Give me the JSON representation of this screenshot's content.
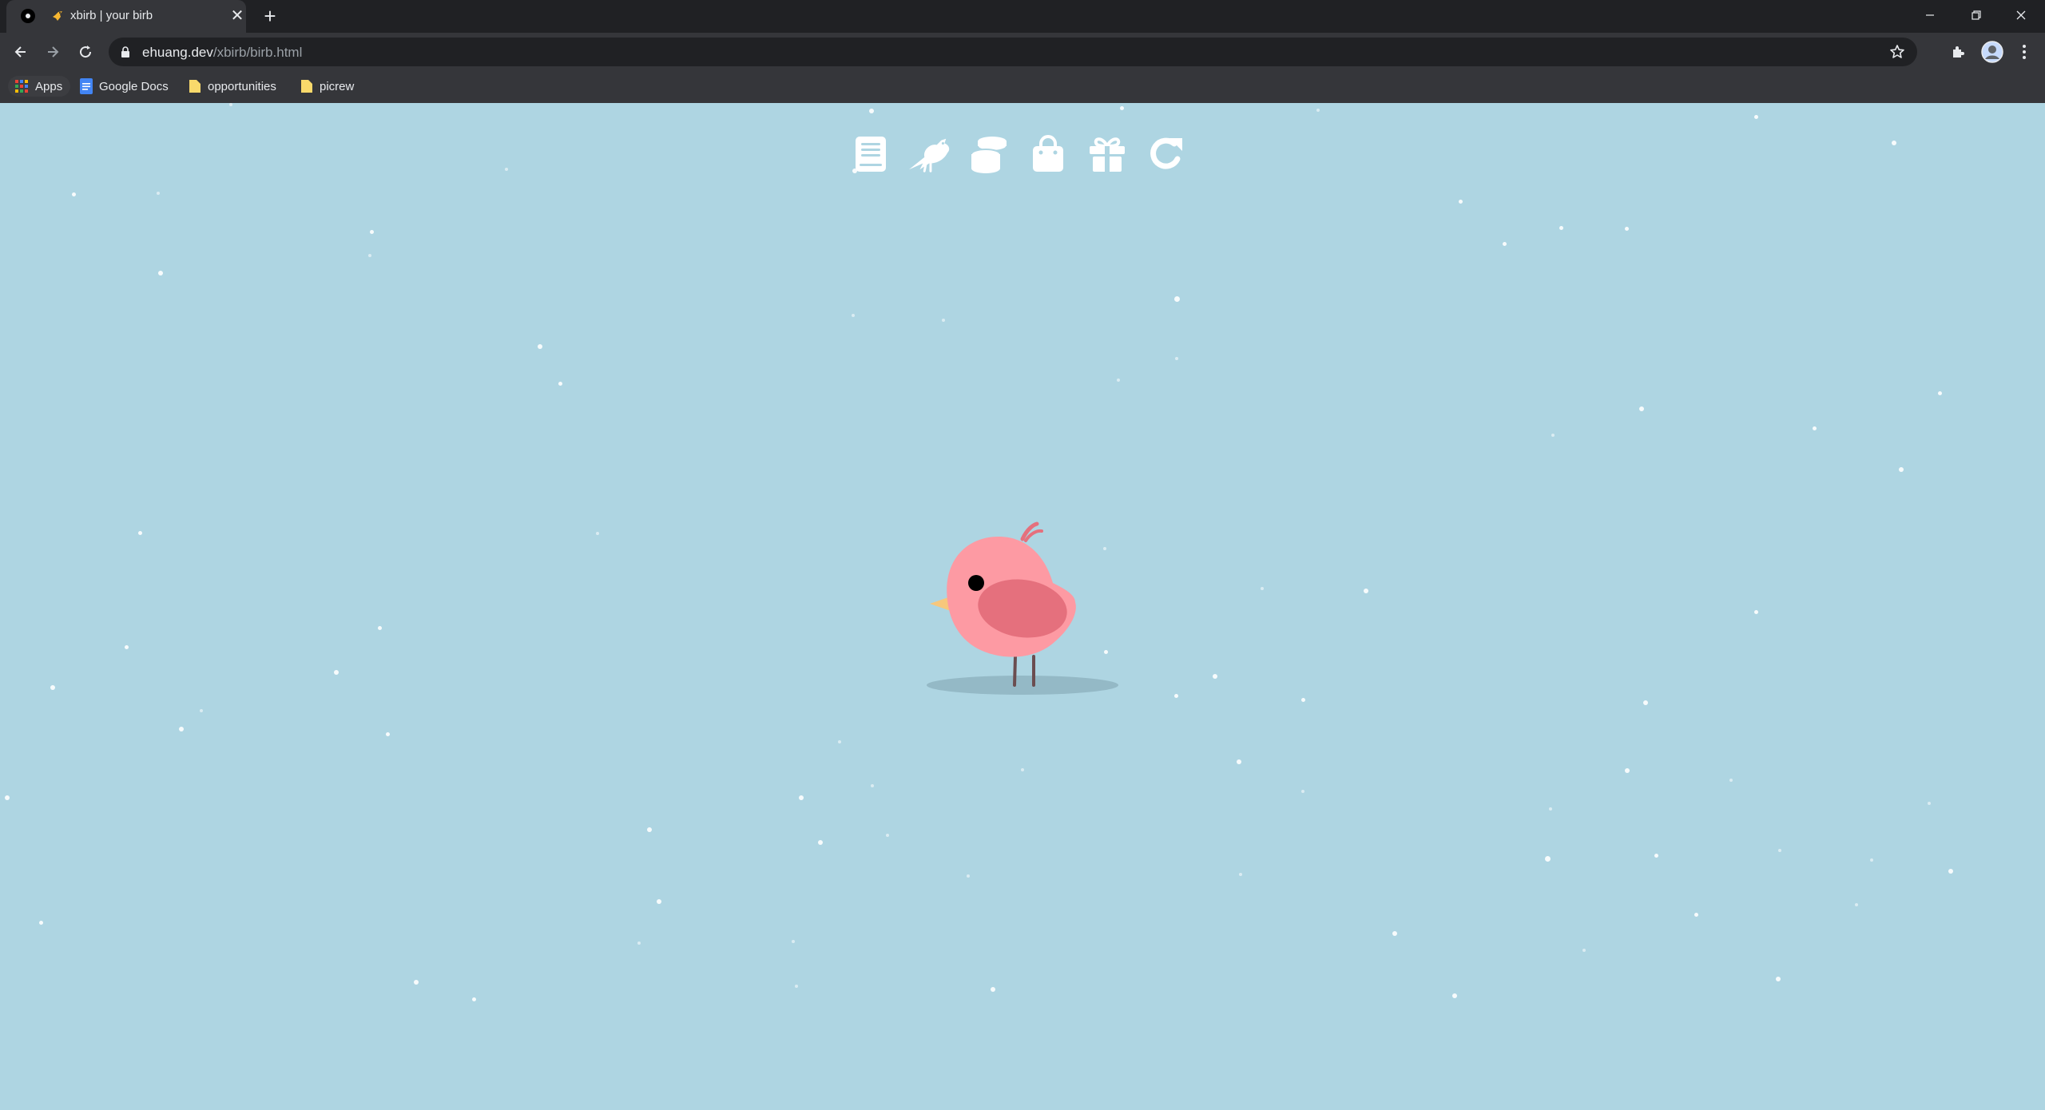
{
  "browser": {
    "tab": {
      "title": "xbirb | your birb",
      "favicon": "bird-favicon-icon",
      "close_icon": "close-icon"
    },
    "new_tab_icon": "plus-icon",
    "window_controls": [
      "minimize-icon",
      "restore-icon",
      "close-icon"
    ],
    "nav": [
      "back-arrow-icon",
      "forward-arrow-icon",
      "reload-icon"
    ],
    "address": {
      "domain": "ehuang.dev",
      "path": "/xbirb/birb.html"
    },
    "toolbar_icons": [
      "star-icon",
      "extensions-puzzle-icon",
      "profile-avatar-icon",
      "more-vertical-icon"
    ],
    "bookmarks": [
      {
        "label": "Apps",
        "icon": "apps-grid-icon"
      },
      {
        "label": "Google Docs",
        "icon": "google-docs-icon"
      },
      {
        "label": "opportunities",
        "icon": "folder-icon"
      },
      {
        "label": "picrew",
        "icon": "folder-icon"
      }
    ]
  },
  "game": {
    "menu": [
      {
        "name": "journal",
        "icon": "book-icon"
      },
      {
        "name": "birb",
        "icon": "bird-silhouette-icon"
      },
      {
        "name": "coins",
        "icon": "coins-stack-icon"
      },
      {
        "name": "shop",
        "icon": "shopping-bag-icon"
      },
      {
        "name": "gift",
        "icon": "gift-icon"
      },
      {
        "name": "reset",
        "icon": "redo-arrow-icon"
      }
    ],
    "colors": {
      "background": "#aed5e2",
      "bird_body": "#fd9aa3",
      "bird_wing": "#e5707d",
      "beak": "#f7c77c",
      "legs": "#6b4d50",
      "shadow": "#94b9c6",
      "snow": "#ffffff"
    }
  }
}
